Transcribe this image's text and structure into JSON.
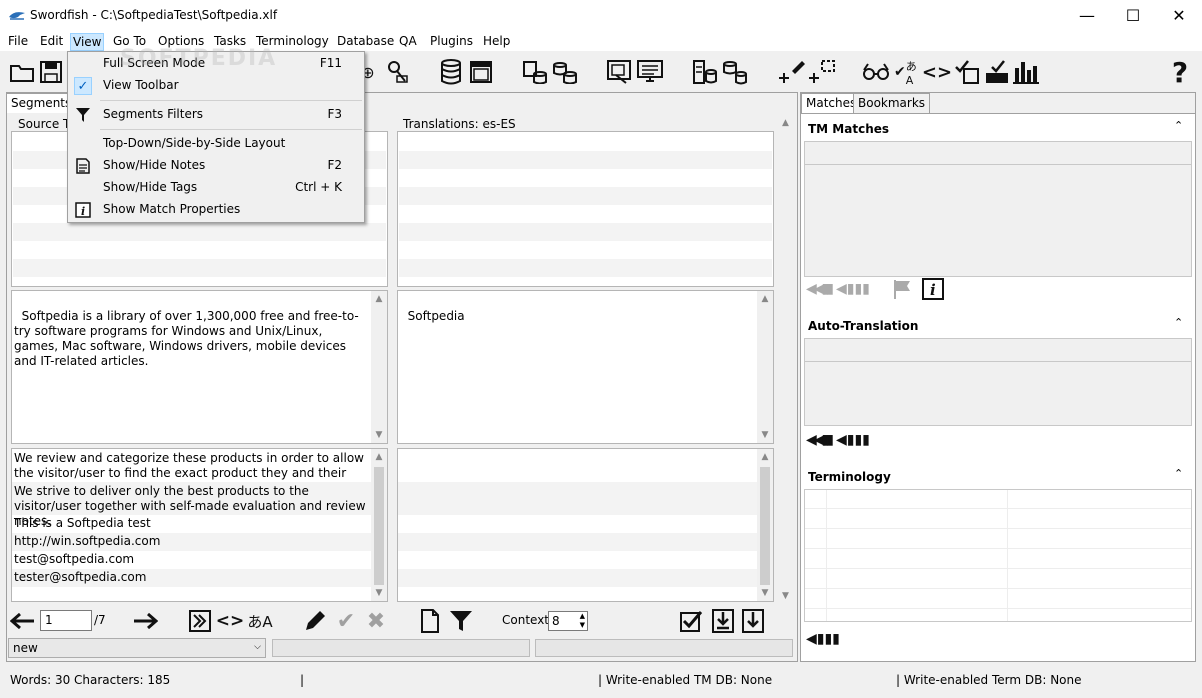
{
  "window": {
    "title": "Swordfish - C:\\SoftpediaTest\\Softpedia.xlf",
    "minimize": "—",
    "maximize": "☐",
    "close": "✕"
  },
  "menu": [
    "File",
    "Edit",
    "View",
    "Go To",
    "Options",
    "Tasks",
    "Terminology",
    "Database",
    "QA",
    "Plugins",
    "Help"
  ],
  "view_menu": {
    "items": [
      {
        "label": "Full Screen Mode",
        "key": "F11"
      },
      {
        "label": "View Toolbar",
        "key": ""
      },
      {
        "label": "Segments Filters",
        "key": "F3"
      },
      {
        "label": "Top-Down/Side-by-Side Layout",
        "key": ""
      },
      {
        "label": "Show/Hide Notes",
        "key": "F2"
      },
      {
        "label": "Show/Hide Tags",
        "key": "Ctrl + K"
      },
      {
        "label": "Show Match Properties",
        "key": ""
      }
    ]
  },
  "left_tabs": {
    "segments": "Segments"
  },
  "columns": {
    "source": "Source Te",
    "translations": "Translations: es-ES"
  },
  "editor": {
    "source_text": "Softpedia is a library of over 1,300,000 free and free-to-try software programs for Windows and Unix/Linux, games, Mac software, Windows drivers, mobile devices and IT-related articles.",
    "target_text": "Softpedia"
  },
  "segments_below": [
    "We review and categorize these products in order to allow the visitor/user to find the exact product they and their system needs.",
    "We strive to deliver only the best products to the visitor/user together with self-made evaluation and review notes.",
    "This is a Softpedia test",
    "http://win.softpedia.com",
    "test@softpedia.com",
    "tester@softpedia.com"
  ],
  "navigation": {
    "segment_number": "1",
    "total": "/7",
    "context_label": "Context:",
    "context_value": "8"
  },
  "status_select": "new",
  "right_tabs": {
    "matches": "Matches",
    "bookmarks": "Bookmarks"
  },
  "sections": {
    "tm_matches": "TM Matches",
    "auto_translation": "Auto-Translation",
    "terminology": "Terminology"
  },
  "statusbar": {
    "words": "Words: 30 Characters: 185",
    "sep1": "|",
    "tm_db": "| Write-enabled TM DB: None",
    "term_db": "| Write-enabled Term DB: None"
  },
  "watermark": "SOFTPEDIA"
}
